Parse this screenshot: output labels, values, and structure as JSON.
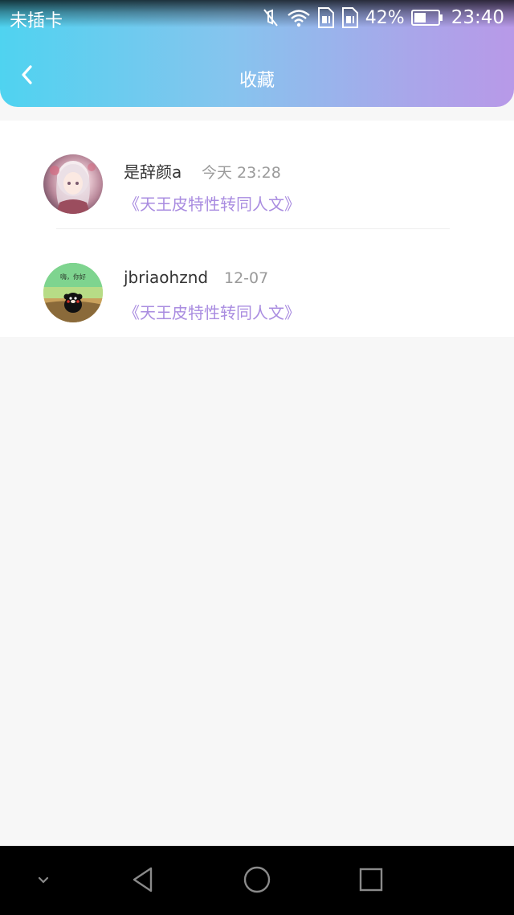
{
  "status_bar": {
    "carrier": "未插卡",
    "battery_percent": "42%",
    "time": "23:40",
    "icons": [
      "mute-icon",
      "wifi-icon",
      "sim1-icon",
      "sim2-icon",
      "battery-icon"
    ]
  },
  "title_bar": {
    "title": "收藏",
    "back_icon": "chevron-left-icon"
  },
  "favorites": [
    {
      "name": "是辞颜a",
      "time": "今天 23:28",
      "book": "《天王皮特性转同人文》",
      "avatar": "anime-girl-avatar"
    },
    {
      "name": "jbriaohznd",
      "time": "12-07",
      "book": "《天王皮特性转同人文》",
      "avatar": "kumamon-avatar"
    }
  ],
  "nav_bar": {
    "buttons": [
      "collapse-icon",
      "back-triangle-icon",
      "home-circle-icon",
      "recent-square-icon"
    ]
  },
  "colors": {
    "header_gradient_start": "#4fd3f0",
    "header_gradient_end": "#b899e8",
    "book_title": "#a98ce0",
    "name_text": "#333333",
    "time_text": "#9a9a9a",
    "background": "#f7f7f7"
  }
}
